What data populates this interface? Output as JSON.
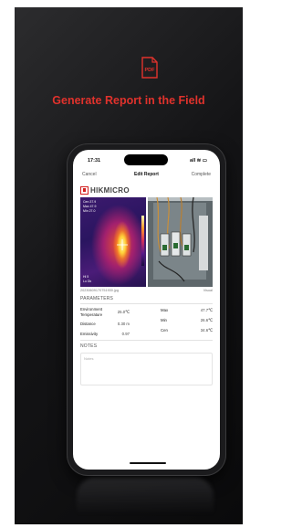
{
  "promo": {
    "headline": "Generate Report in the Field",
    "icon_label": "PDF",
    "accent_color": "#e0322c"
  },
  "status_bar": {
    "time": "17:31",
    "signal_icons": "all ≋ ▭"
  },
  "nav": {
    "cancel_label": "Cancel",
    "title": "Edit Report",
    "complete_label": "Complete"
  },
  "brand": {
    "name": "HIKMICRO",
    "brand_color": "#d21f1f"
  },
  "thermal_image": {
    "overlay_lines": [
      "Cen  37.9",
      "Max  47.9",
      "Min  27.0"
    ],
    "corner_lines": [
      "Hi  5",
      "Lo  Dk"
    ]
  },
  "image_meta": {
    "filename": "20230609170751930.jpg",
    "camera": "Visual"
  },
  "parameters": {
    "section_title": "PARAMETERS",
    "rows": [
      {
        "label": "Environment Temperature",
        "value": "25.0℃"
      },
      {
        "label": "Distance",
        "value": "0.30 m"
      },
      {
        "label": "Emissivity",
        "value": "0.97"
      }
    ],
    "stats": [
      {
        "label": "Max",
        "value": "47.7℃"
      },
      {
        "label": "Min",
        "value": "26.6℃"
      },
      {
        "label": "Cen",
        "value": "34.6℃"
      }
    ]
  },
  "notes": {
    "section_title": "NOTES",
    "placeholder": "Notes"
  }
}
